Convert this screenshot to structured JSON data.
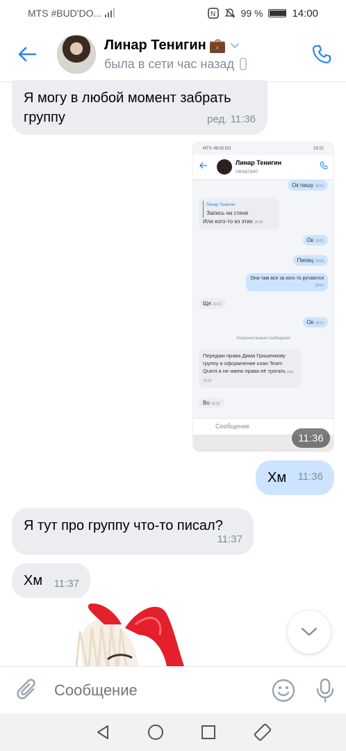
{
  "status_bar": {
    "carrier": "MTS #BUD'DO...",
    "battery": "99 %",
    "time": "14:00"
  },
  "header": {
    "name": "Линар Тенигин",
    "name_emoji": "💼",
    "last_seen": "была в сети час назад"
  },
  "messages": [
    {
      "text": "Я могу в любой момент забрать группу",
      "meta": "ред. 11:36"
    },
    {
      "text": "Хм",
      "meta": "11:36"
    },
    {
      "text": "Я тут про группу что-то писал?",
      "meta": "11:37"
    },
    {
      "text": "Хм",
      "meta": "11:37"
    }
  ],
  "screenshot_time": "11:36",
  "embedded": {
    "status": "MTS #BUD'DO",
    "name": "Линар Тенигин",
    "typing": "печатает",
    "messages": [
      {
        "text": "Ок пишу",
        "time": "18:53"
      },
      {
        "reply": "Линар Тенигин",
        "quote": "Запись на стене",
        "text": "Или кого-то из этих",
        "time": "18:56"
      },
      {
        "text": "Ок",
        "time": "18:55"
      },
      {
        "text": "Пипец",
        "time": "18:59"
      },
      {
        "text": "Они там все за кого то ручаются",
        "time": "18:59"
      },
      {
        "text": "Щя",
        "time": "19:21"
      },
      {
        "text": "Ок",
        "time": "19:21"
      },
      {
        "divider": "Непрочитанные сообщения"
      },
      {
        "text": "Передаю права Дима Гришенкову группу и оформление клан Team Quent и не имею права её трогать",
        "time": "ред. 19:22"
      },
      {
        "text": "Во",
        "time": "19:22"
      }
    ],
    "composer": "Сообщение"
  },
  "composer": {
    "placeholder": "Сообщение"
  },
  "colors": {
    "accent": "#2688eb",
    "in_bubble": "#ebedf0",
    "out_bubble": "#cce4ff",
    "meta": "#818c99"
  }
}
